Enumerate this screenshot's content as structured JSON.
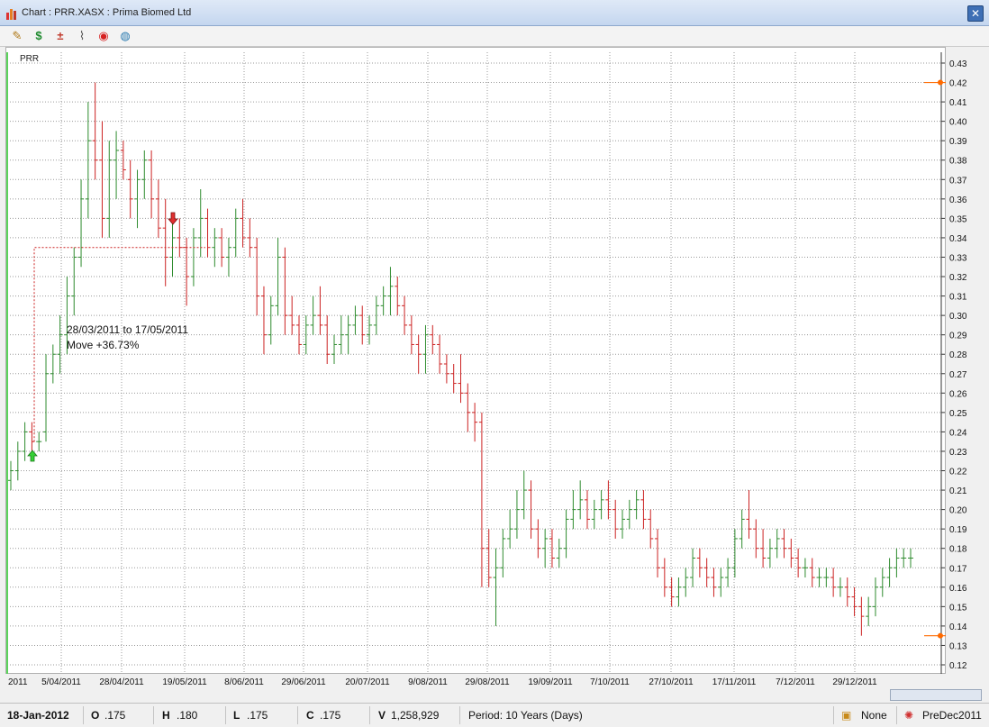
{
  "window": {
    "title": "Chart : PRR.XASX : Prima Biomed Ltd",
    "close_label": "✕"
  },
  "toolbar": {
    "icons": [
      "notes-icon",
      "dollar-icon",
      "calculator-icon",
      "paperclip-icon",
      "broadcast-icon",
      "globe-icon"
    ],
    "glyphs": [
      "✎",
      "$",
      "±",
      "⌇",
      "◉",
      "◍"
    ]
  },
  "status": {
    "date": "18-Jan-2012",
    "open_label": "O",
    "open": ".175",
    "high_label": "H",
    "high": ".180",
    "low_label": "L",
    "low": ".175",
    "close_label": "C",
    "close": ".175",
    "vol_label": "V",
    "vol": "1,258,929",
    "period": "Period: 10 Years (Days)",
    "template": "None",
    "layout": "PreDec2011"
  },
  "colors": {
    "up": "#2e8b2e",
    "down": "#cc2222",
    "grid": "#9a9a9a",
    "marker": "#ff6a00"
  },
  "chart_data": {
    "type": "ohlc",
    "series_label": "PRR",
    "ylim": [
      0.12,
      0.43
    ],
    "y_ticks": [
      "0.12",
      "0.13",
      "0.14",
      "0.15",
      "0.16",
      "0.17",
      "0.18",
      "0.19",
      "0.20",
      "0.21",
      "0.22",
      "0.23",
      "0.24",
      "0.25",
      "0.26",
      "0.27",
      "0.28",
      "0.29",
      "0.30",
      "0.31",
      "0.32",
      "0.33",
      "0.34",
      "0.35",
      "0.36",
      "0.37",
      "0.38",
      "0.39",
      "0.40",
      "0.41",
      "0.42",
      "0.43"
    ],
    "x_ticks": [
      "2011",
      "5/04/2011",
      "28/04/2011",
      "19/05/2011",
      "8/06/2011",
      "29/06/2011",
      "20/07/2011",
      "9/08/2011",
      "29/08/2011",
      "19/09/2011",
      "7/10/2011",
      "27/10/2011",
      "17/11/2011",
      "7/12/2011",
      "29/12/2011"
    ],
    "annotation": {
      "line1": "28/03/2011 to 17/05/2011",
      "line2": "Move +36.73%",
      "from_price": 0.235,
      "to_price": 0.335
    },
    "markers": {
      "upper_price": 0.42,
      "lower_price": 0.135
    },
    "bars": [
      [
        0.215,
        0.225,
        0.21,
        0.22
      ],
      [
        0.22,
        0.235,
        0.215,
        0.23
      ],
      [
        0.23,
        0.245,
        0.225,
        0.24
      ],
      [
        0.24,
        0.245,
        0.23,
        0.235
      ],
      [
        0.235,
        0.24,
        0.23,
        0.235
      ],
      [
        0.24,
        0.28,
        0.235,
        0.27
      ],
      [
        0.27,
        0.285,
        0.265,
        0.28
      ],
      [
        0.28,
        0.3,
        0.27,
        0.29
      ],
      [
        0.29,
        0.32,
        0.28,
        0.31
      ],
      [
        0.31,
        0.335,
        0.3,
        0.33
      ],
      [
        0.33,
        0.37,
        0.325,
        0.36
      ],
      [
        0.36,
        0.41,
        0.35,
        0.39
      ],
      [
        0.39,
        0.42,
        0.37,
        0.38
      ],
      [
        0.38,
        0.4,
        0.34,
        0.35
      ],
      [
        0.35,
        0.39,
        0.34,
        0.38
      ],
      [
        0.38,
        0.395,
        0.36,
        0.385
      ],
      [
        0.385,
        0.39,
        0.37,
        0.375
      ],
      [
        0.37,
        0.38,
        0.35,
        0.36
      ],
      [
        0.36,
        0.375,
        0.345,
        0.37
      ],
      [
        0.37,
        0.385,
        0.36,
        0.38
      ],
      [
        0.38,
        0.385,
        0.35,
        0.36
      ],
      [
        0.36,
        0.37,
        0.34,
        0.345
      ],
      [
        0.345,
        0.36,
        0.315,
        0.33
      ],
      [
        0.33,
        0.35,
        0.32,
        0.34
      ],
      [
        0.34,
        0.35,
        0.33,
        0.335
      ],
      [
        0.335,
        0.34,
        0.305,
        0.32
      ],
      [
        0.32,
        0.345,
        0.315,
        0.34
      ],
      [
        0.34,
        0.365,
        0.33,
        0.35
      ],
      [
        0.35,
        0.355,
        0.33,
        0.335
      ],
      [
        0.335,
        0.345,
        0.325,
        0.34
      ],
      [
        0.34,
        0.345,
        0.325,
        0.33
      ],
      [
        0.33,
        0.34,
        0.32,
        0.335
      ],
      [
        0.335,
        0.355,
        0.33,
        0.35
      ],
      [
        0.35,
        0.36,
        0.335,
        0.34
      ],
      [
        0.34,
        0.35,
        0.33,
        0.335
      ],
      [
        0.335,
        0.34,
        0.3,
        0.31
      ],
      [
        0.31,
        0.315,
        0.28,
        0.29
      ],
      [
        0.29,
        0.31,
        0.285,
        0.305
      ],
      [
        0.305,
        0.34,
        0.3,
        0.33
      ],
      [
        0.33,
        0.335,
        0.29,
        0.3
      ],
      [
        0.3,
        0.31,
        0.29,
        0.295
      ],
      [
        0.295,
        0.3,
        0.28,
        0.285
      ],
      [
        0.285,
        0.3,
        0.28,
        0.295
      ],
      [
        0.295,
        0.31,
        0.29,
        0.3
      ],
      [
        0.3,
        0.315,
        0.29,
        0.295
      ],
      [
        0.295,
        0.3,
        0.275,
        0.28
      ],
      [
        0.28,
        0.29,
        0.275,
        0.285
      ],
      [
        0.285,
        0.3,
        0.28,
        0.29
      ],
      [
        0.29,
        0.3,
        0.28,
        0.295
      ],
      [
        0.295,
        0.305,
        0.29,
        0.3
      ],
      [
        0.3,
        0.305,
        0.285,
        0.29
      ],
      [
        0.29,
        0.3,
        0.285,
        0.295
      ],
      [
        0.295,
        0.31,
        0.29,
        0.305
      ],
      [
        0.305,
        0.315,
        0.3,
        0.31
      ],
      [
        0.31,
        0.325,
        0.3,
        0.315
      ],
      [
        0.315,
        0.32,
        0.3,
        0.305
      ],
      [
        0.305,
        0.31,
        0.29,
        0.295
      ],
      [
        0.295,
        0.3,
        0.28,
        0.285
      ],
      [
        0.285,
        0.29,
        0.27,
        0.28
      ],
      [
        0.28,
        0.295,
        0.27,
        0.29
      ],
      [
        0.29,
        0.295,
        0.28,
        0.285
      ],
      [
        0.285,
        0.29,
        0.27,
        0.275
      ],
      [
        0.275,
        0.28,
        0.265,
        0.27
      ],
      [
        0.27,
        0.275,
        0.26,
        0.265
      ],
      [
        0.265,
        0.28,
        0.255,
        0.26
      ],
      [
        0.26,
        0.265,
        0.24,
        0.25
      ],
      [
        0.25,
        0.255,
        0.235,
        0.245
      ],
      [
        0.245,
        0.25,
        0.16,
        0.18
      ],
      [
        0.18,
        0.19,
        0.16,
        0.165
      ],
      [
        0.165,
        0.18,
        0.14,
        0.17
      ],
      [
        0.17,
        0.19,
        0.165,
        0.185
      ],
      [
        0.185,
        0.2,
        0.18,
        0.19
      ],
      [
        0.19,
        0.21,
        0.185,
        0.2
      ],
      [
        0.2,
        0.22,
        0.195,
        0.21
      ],
      [
        0.21,
        0.215,
        0.185,
        0.19
      ],
      [
        0.19,
        0.195,
        0.175,
        0.18
      ],
      [
        0.18,
        0.19,
        0.17,
        0.185
      ],
      [
        0.185,
        0.19,
        0.17,
        0.175
      ],
      [
        0.175,
        0.185,
        0.17,
        0.18
      ],
      [
        0.18,
        0.2,
        0.175,
        0.195
      ],
      [
        0.195,
        0.21,
        0.19,
        0.2
      ],
      [
        0.2,
        0.215,
        0.195,
        0.205
      ],
      [
        0.205,
        0.21,
        0.19,
        0.195
      ],
      [
        0.195,
        0.205,
        0.19,
        0.2
      ],
      [
        0.2,
        0.21,
        0.195,
        0.205
      ],
      [
        0.205,
        0.215,
        0.195,
        0.2
      ],
      [
        0.2,
        0.205,
        0.185,
        0.19
      ],
      [
        0.19,
        0.2,
        0.185,
        0.195
      ],
      [
        0.195,
        0.205,
        0.19,
        0.2
      ],
      [
        0.2,
        0.21,
        0.195,
        0.205
      ],
      [
        0.205,
        0.21,
        0.19,
        0.195
      ],
      [
        0.195,
        0.2,
        0.18,
        0.185
      ],
      [
        0.185,
        0.19,
        0.165,
        0.17
      ],
      [
        0.17,
        0.175,
        0.155,
        0.16
      ],
      [
        0.16,
        0.165,
        0.15,
        0.155
      ],
      [
        0.155,
        0.165,
        0.15,
        0.16
      ],
      [
        0.16,
        0.17,
        0.155,
        0.165
      ],
      [
        0.165,
        0.18,
        0.16,
        0.175
      ],
      [
        0.175,
        0.18,
        0.165,
        0.17
      ],
      [
        0.17,
        0.175,
        0.16,
        0.165
      ],
      [
        0.165,
        0.17,
        0.155,
        0.16
      ],
      [
        0.16,
        0.17,
        0.155,
        0.165
      ],
      [
        0.165,
        0.175,
        0.16,
        0.17
      ],
      [
        0.17,
        0.19,
        0.165,
        0.185
      ],
      [
        0.185,
        0.2,
        0.18,
        0.195
      ],
      [
        0.195,
        0.21,
        0.185,
        0.19
      ],
      [
        0.19,
        0.195,
        0.175,
        0.18
      ],
      [
        0.18,
        0.19,
        0.17,
        0.175
      ],
      [
        0.175,
        0.185,
        0.17,
        0.18
      ],
      [
        0.18,
        0.19,
        0.175,
        0.185
      ],
      [
        0.185,
        0.19,
        0.175,
        0.18
      ],
      [
        0.18,
        0.185,
        0.17,
        0.175
      ],
      [
        0.175,
        0.18,
        0.165,
        0.17
      ],
      [
        0.17,
        0.175,
        0.165,
        0.17
      ],
      [
        0.17,
        0.175,
        0.16,
        0.165
      ],
      [
        0.165,
        0.17,
        0.16,
        0.165
      ],
      [
        0.165,
        0.17,
        0.16,
        0.165
      ],
      [
        0.165,
        0.17,
        0.155,
        0.16
      ],
      [
        0.16,
        0.165,
        0.155,
        0.16
      ],
      [
        0.16,
        0.165,
        0.15,
        0.155
      ],
      [
        0.155,
        0.16,
        0.145,
        0.15
      ],
      [
        0.15,
        0.155,
        0.135,
        0.145
      ],
      [
        0.145,
        0.155,
        0.14,
        0.15
      ],
      [
        0.15,
        0.165,
        0.145,
        0.16
      ],
      [
        0.16,
        0.17,
        0.155,
        0.165
      ],
      [
        0.165,
        0.175,
        0.16,
        0.17
      ],
      [
        0.17,
        0.18,
        0.165,
        0.175
      ],
      [
        0.175,
        0.18,
        0.17,
        0.175
      ],
      [
        0.175,
        0.18,
        0.17,
        0.175
      ]
    ]
  }
}
